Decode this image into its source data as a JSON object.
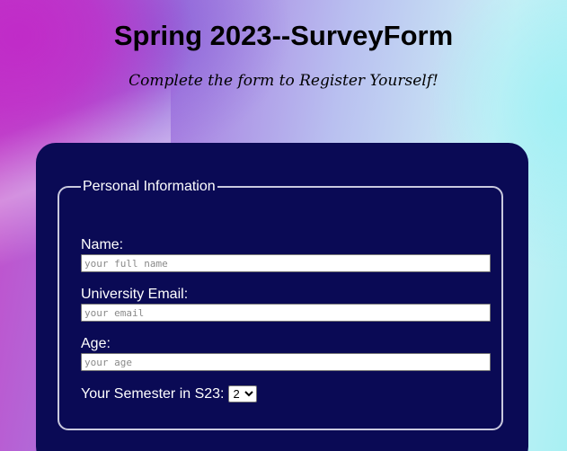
{
  "header": {
    "title": "Spring 2023--SurveyForm",
    "subtitle": "Complete the form to Register Yourself!"
  },
  "form": {
    "legend": "Personal Information",
    "fields": {
      "name": {
        "label": "Name:",
        "placeholder": "your full name",
        "value": ""
      },
      "email": {
        "label": "University Email:",
        "placeholder": "your email",
        "value": ""
      },
      "age": {
        "label": "Age:",
        "placeholder": "your age",
        "value": ""
      }
    },
    "semester": {
      "label": "Your Semester in S23:",
      "selected": "2"
    }
  },
  "colors": {
    "card_background": "#0a0a55",
    "fieldset_border": "#c9c9de",
    "label_text": "#ffffff"
  }
}
